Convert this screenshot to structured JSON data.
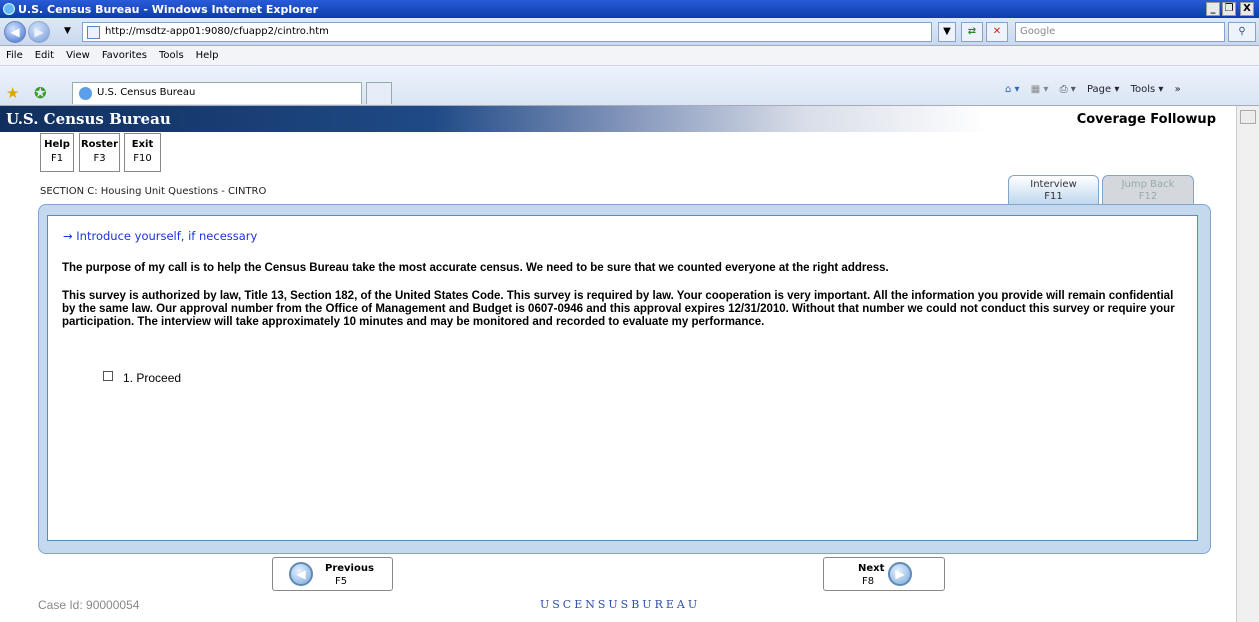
{
  "window": {
    "title": "U.S. Census Bureau - Windows Internet Explorer",
    "min": "_",
    "max": "❐",
    "close": "X"
  },
  "address": {
    "url": "http://msdtz-app01:9080/cfuapp2/cintro.htm",
    "search_placeholder": "Google"
  },
  "menu": [
    "File",
    "Edit",
    "View",
    "Favorites",
    "Tools",
    "Help"
  ],
  "browser_tab": {
    "label": "U.S. Census Bureau"
  },
  "browser_tools": {
    "page": "Page ▾",
    "tools": "Tools ▾"
  },
  "header": {
    "brand": "U.S. Census Bureau",
    "product": "Coverage Followup"
  },
  "fkeys": [
    {
      "name": "Help",
      "key": "F1"
    },
    {
      "name": "Roster",
      "key": "F3"
    },
    {
      "name": "Exit",
      "key": "F10"
    }
  ],
  "section_title": "SECTION C: Housing Unit Questions - CINTRO",
  "tabs": {
    "interview": {
      "name": "Interview",
      "key": "F11"
    },
    "jump_back": {
      "name": "Jump Back",
      "key": "F12"
    }
  },
  "content": {
    "instruction": "→  Introduce yourself, if necessary",
    "para1": "The purpose of my call is to help the Census Bureau take the most accurate census. We need to be sure that we counted everyone at the right address.",
    "para2": "This survey is authorized by law, Title 13, Section 182, of the United States Code. This survey is required by law. Your cooperation is very important. All the information you provide will remain confidential by the same law. Our approval number from the Office of Management and Budget is 0607-0946 and this approval expires 12/31/2010. Without that number we could not conduct this survey or require your participation. The interview will take approximately 10 minutes and may be monitored and recorded to evaluate my performance.",
    "option1": "1. Proceed"
  },
  "nav": {
    "previous": {
      "name": "Previous",
      "key": "F5"
    },
    "next": {
      "name": "Next",
      "key": "F8"
    }
  },
  "case_id": "Case Id: 90000054",
  "footer_logo": "USCENSUSBUREAU"
}
